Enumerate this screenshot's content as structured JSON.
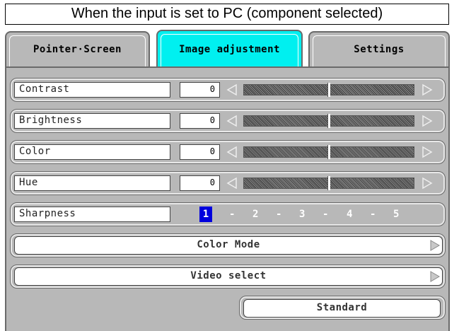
{
  "caption": "When the input is set to PC (component selected)",
  "tabs": [
    {
      "label": "Pointer·Screen",
      "active": false
    },
    {
      "label": "Image adjustment",
      "active": true
    },
    {
      "label": "Settings",
      "active": false
    }
  ],
  "sliders": [
    {
      "label": "Contrast",
      "value": "0"
    },
    {
      "label": "Brightness",
      "value": "0"
    },
    {
      "label": "Color",
      "value": "0"
    },
    {
      "label": "Hue",
      "value": "0"
    }
  ],
  "sharpness": {
    "label": "Sharpness",
    "levels": [
      "1",
      "2",
      "3",
      "4",
      "5"
    ],
    "selected": "1",
    "separator": "-"
  },
  "color_mode": {
    "label": "Color Mode"
  },
  "video_select": {
    "label": "Video select"
  },
  "standard": {
    "label": "Standard"
  },
  "colors": {
    "active_tab": "#00f0f0",
    "panel": "#b8b8b8",
    "selected_level": "#0000dd"
  }
}
